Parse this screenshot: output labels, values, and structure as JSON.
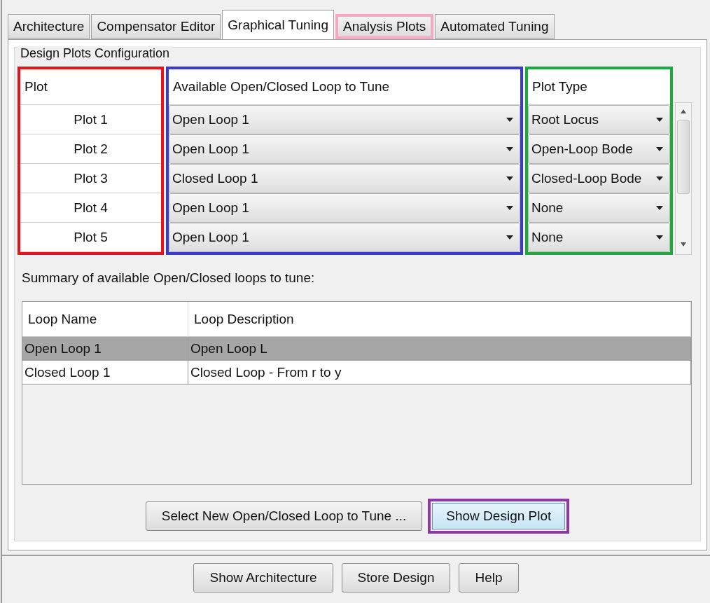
{
  "tabs": [
    {
      "label": "Architecture",
      "selected": false
    },
    {
      "label": "Compensator Editor",
      "selected": false
    },
    {
      "label": "Graphical Tuning",
      "selected": true
    },
    {
      "label": "Analysis Plots",
      "selected": false,
      "color": "#f4a8c4"
    },
    {
      "label": "Automated Tuning",
      "selected": false
    }
  ],
  "design_plots": {
    "title": "Design Plots Configuration",
    "columns": [
      {
        "label": "Plot",
        "color": "#e8141c"
      },
      {
        "label": "Available Open/Closed Loop to Tune",
        "color": "#3a3ad0"
      },
      {
        "label": "Plot Type",
        "color": "#1fa83c"
      }
    ],
    "rows": [
      {
        "plot": "Plot 1",
        "loop": "Open Loop 1",
        "type": "Root Locus"
      },
      {
        "plot": "Plot 2",
        "loop": "Open Loop 1",
        "type": "Open-Loop Bode"
      },
      {
        "plot": "Plot 3",
        "loop": "Closed Loop 1",
        "type": "Closed-Loop Bode"
      },
      {
        "plot": "Plot 4",
        "loop": "Open Loop 1",
        "type": "None"
      },
      {
        "plot": "Plot 5",
        "loop": "Open Loop 1",
        "type": "None"
      }
    ]
  },
  "summary": {
    "label": "Summary of available Open/Closed loops to tune:",
    "columns": [
      "Loop Name",
      "Loop Description"
    ],
    "rows": [
      {
        "name": "Open Loop 1",
        "description": "Open Loop L",
        "selected": true
      },
      {
        "name": "Closed Loop 1",
        "description": "Closed Loop - From r to y",
        "selected": false
      }
    ]
  },
  "actions": [
    {
      "label": "Select New Open/Closed Loop to Tune ..."
    },
    {
      "label": "Show Design Plot",
      "color": "#8e3aa6",
      "focused": true
    }
  ],
  "footer_buttons": [
    "Show Architecture",
    "Store Design",
    "Help"
  ]
}
